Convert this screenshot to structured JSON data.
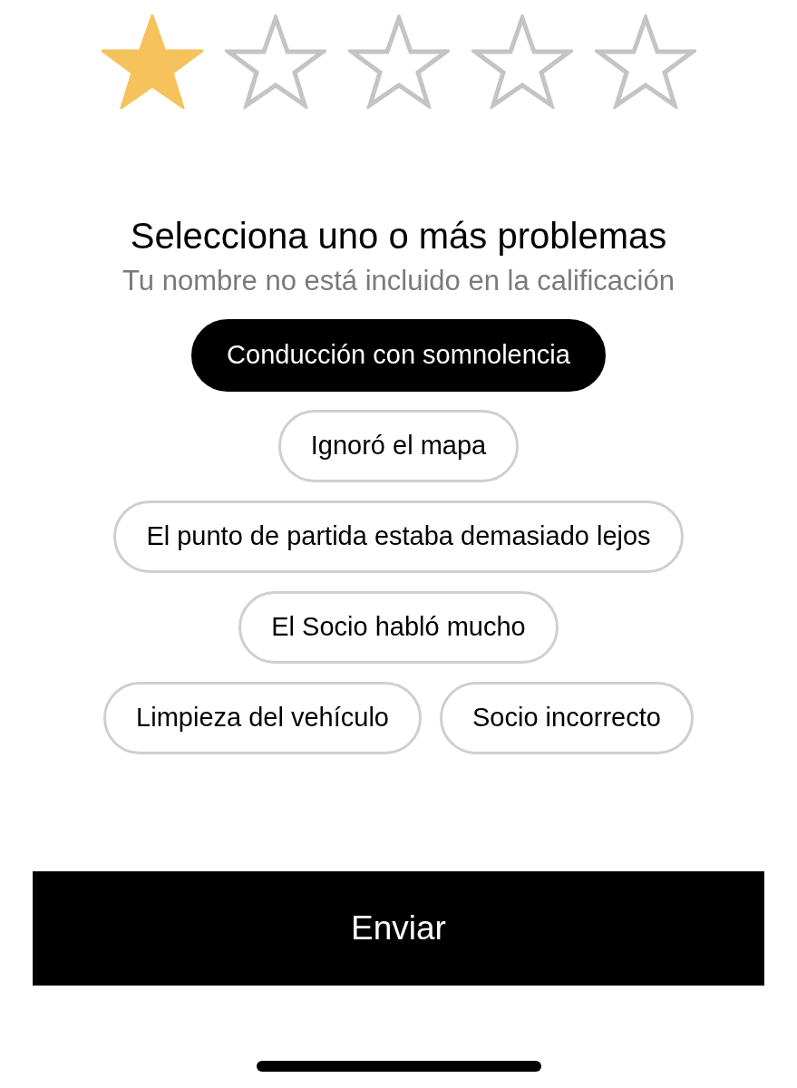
{
  "rating": {
    "stars": 1
  },
  "title": "Selecciona uno o más problemas",
  "subtitle": "Tu nombre no está incluido en la calificación",
  "issue_rows": [
    [
      {
        "label": "Conducción con somnolencia",
        "selected": true
      }
    ],
    [
      {
        "label": "Ignoró el mapa",
        "selected": false
      }
    ],
    [
      {
        "label": "El punto de partida estaba demasiado lejos",
        "selected": false
      }
    ],
    [
      {
        "label": "El Socio habló mucho",
        "selected": false
      }
    ],
    [
      {
        "label": "Limpieza del vehículo",
        "selected": false
      },
      {
        "label": "Socio incorrecto",
        "selected": false
      }
    ]
  ],
  "submit": "Enviar"
}
